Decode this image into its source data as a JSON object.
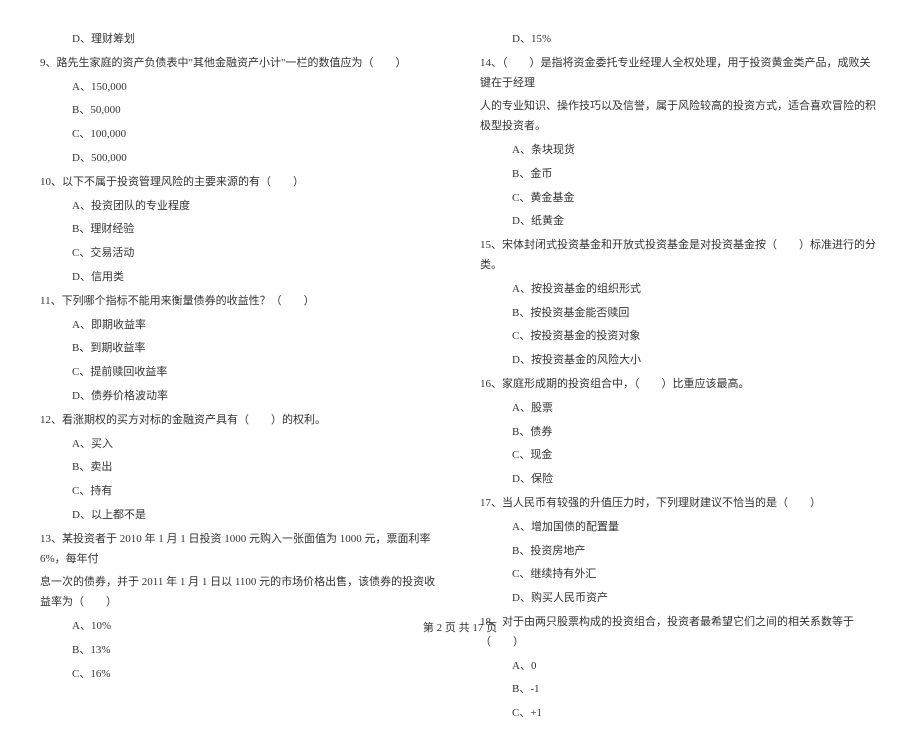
{
  "left": {
    "opt_d_prev": "D、理财筹划",
    "q9": {
      "stem": "9、路先生家庭的资产负债表中\"其他金融资产小计\"一栏的数值应为（　　）",
      "a": "A、150,000",
      "b": "B、50,000",
      "c": "C、100,000",
      "d": "D、500,000"
    },
    "q10": {
      "stem": "10、以下不属于投资管理风险的主要来源的有（　　）",
      "a": "A、投资团队的专业程度",
      "b": "B、理财经验",
      "c": "C、交易活动",
      "d": "D、信用类"
    },
    "q11": {
      "stem": "11、下列哪个指标不能用来衡量债券的收益性？（　　）",
      "a": "A、即期收益率",
      "b": "B、到期收益率",
      "c": "C、提前赎回收益率",
      "d": "D、债券价格波动率"
    },
    "q12": {
      "stem": "12、看涨期权的买方对标的金融资产具有（　　）的权利。",
      "a": "A、买入",
      "b": "B、卖出",
      "c": "C、持有",
      "d": "D、以上都不是"
    },
    "q13": {
      "stem_l1": "13、某投资者于 2010 年 1 月 1 日投资 1000 元购入一张面值为 1000 元，票面利率 6%，每年付",
      "stem_l2": "息一次的债券，并于 2011 年 1 月 1 日以 1100 元的市场价格出售，该债券的投资收益率为（　　）",
      "a": "A、10%",
      "b": "B、13%",
      "c": "C、16%"
    }
  },
  "right": {
    "opt_d_prev": "D、15%",
    "q14": {
      "stem_l1": "14、（　　）是指将资金委托专业经理人全权处理，用于投资黄金类产品，成败关键在于经理",
      "stem_l2": "人的专业知识、操作技巧以及信誉，属于风险较高的投资方式，适合喜欢冒险的积极型投资者。",
      "a": "A、条块现货",
      "b": "B、金币",
      "c": "C、黄金基金",
      "d": "D、纸黄金"
    },
    "q15": {
      "stem": "15、宋体封闭式投资基金和开放式投资基金是对投资基金按（　　）标准进行的分类。",
      "a": "A、按投资基金的组织形式",
      "b": "B、按投资基金能否赎回",
      "c": "C、按投资基金的投资对象",
      "d": "D、按投资基金的风险大小"
    },
    "q16": {
      "stem": "16、家庭形成期的投资组合中，（　　）比重应该最高。",
      "a": "A、股票",
      "b": "B、债券",
      "c": "C、现金",
      "d": "D、保险"
    },
    "q17": {
      "stem": "17、当人民币有较强的升值压力时，下列理财建议不恰当的是（　　）",
      "a": "A、增加国债的配置量",
      "b": "B、投资房地产",
      "c": "C、继续持有外汇",
      "d": "D、购买人民币资产"
    },
    "q18": {
      "stem": "18、对于由两只股票构成的投资组合，投资者最希望它们之间的相关系数等于（　　）",
      "a": "A、0",
      "b": "B、-1",
      "c": "C、+1"
    }
  },
  "footer": "第 2 页 共 17 页"
}
